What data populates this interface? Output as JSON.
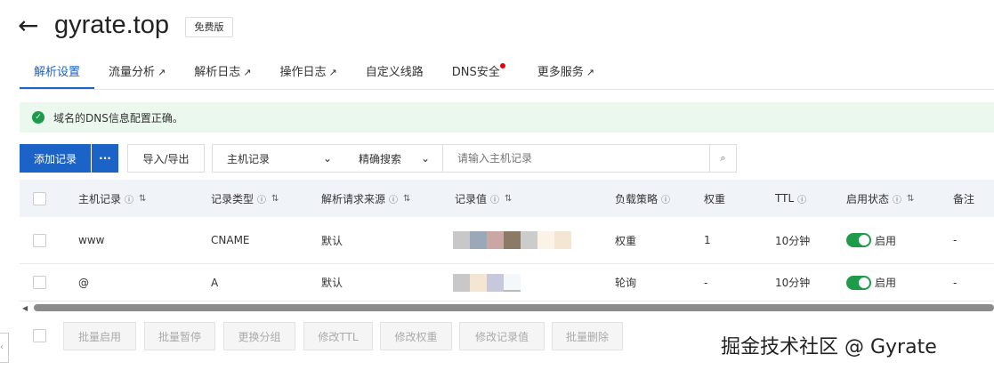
{
  "header": {
    "title": "gyrate.top",
    "badge": "免费版"
  },
  "tabs": [
    {
      "label": "解析设置",
      "active": true
    },
    {
      "label": "流量分析",
      "external": true
    },
    {
      "label": "解析日志",
      "external": true
    },
    {
      "label": "操作日志",
      "external": true
    },
    {
      "label": "自定义线路"
    },
    {
      "label": "DNS安全",
      "dot": true
    },
    {
      "label": "更多服务",
      "external": true
    }
  ],
  "banner": "域名的DNS信息配置正确。",
  "toolbar": {
    "add": "添加记录",
    "more": "···",
    "import_export": "导入/导出",
    "field_select": "主机记录",
    "match_select": "精确搜索",
    "search_placeholder": "请输入主机记录"
  },
  "table": {
    "headers": [
      "主机记录",
      "记录类型",
      "解析请求来源",
      "记录值",
      "负载策略",
      "权重",
      "TTL",
      "启用状态",
      "备注"
    ],
    "rows": [
      {
        "host": "www",
        "type": "CNAME",
        "source": "默认",
        "lb": "权重",
        "weight": "1",
        "ttl": "10分钟",
        "status": "启用",
        "note": "-"
      },
      {
        "host": "@",
        "type": "A",
        "source": "默认",
        "lb": "轮询",
        "weight": "-",
        "ttl": "10分钟",
        "status": "启用",
        "note": "-"
      }
    ]
  },
  "batch": [
    "批量启用",
    "批量暂停",
    "更换分组",
    "修改TTL",
    "修改权重",
    "修改记录值",
    "批量删除"
  ],
  "watermark": "掘金技术社区 @ Gyrate",
  "colors": {
    "primary": "#1b63c6",
    "success": "#1d9a4a"
  }
}
